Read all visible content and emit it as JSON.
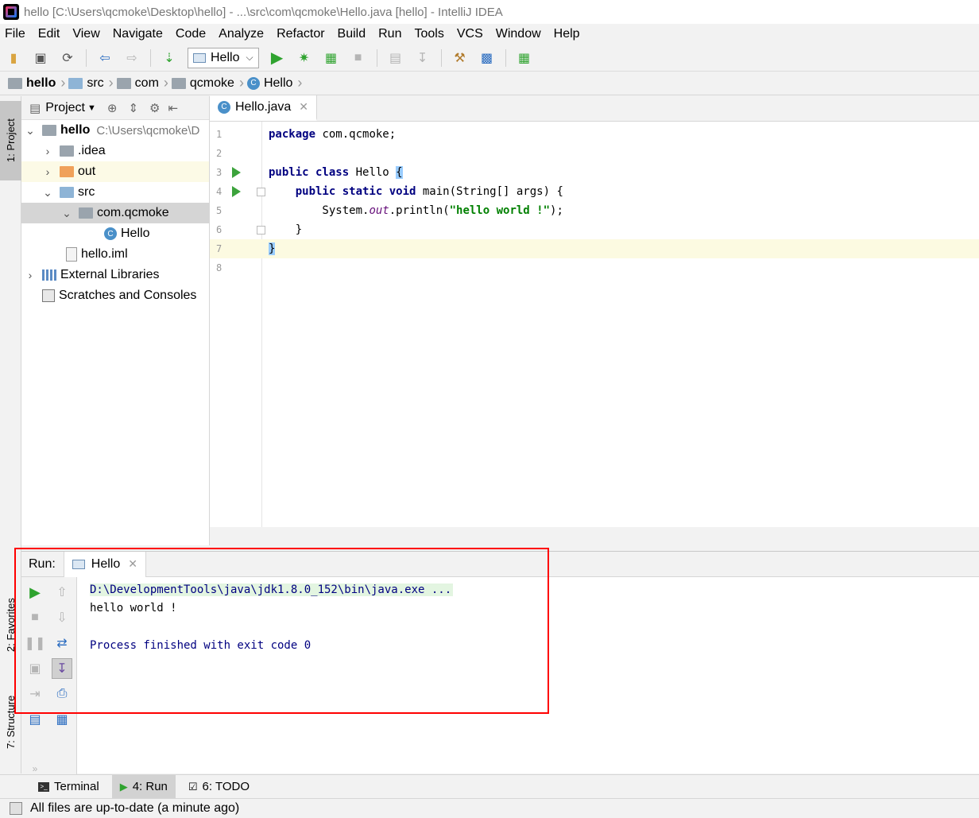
{
  "window": {
    "title": "hello [C:\\Users\\qcmoke\\Desktop\\hello] - ...\\src\\com\\qcmoke\\Hello.java [hello] - IntelliJ IDEA"
  },
  "menubar": {
    "items": [
      "File",
      "Edit",
      "View",
      "Navigate",
      "Code",
      "Analyze",
      "Refactor",
      "Build",
      "Run",
      "Tools",
      "VCS",
      "Window",
      "Help"
    ]
  },
  "toolbar": {
    "run_config": "Hello"
  },
  "breadcrumb": {
    "items": [
      "hello",
      "src",
      "com",
      "qcmoke",
      "Hello"
    ]
  },
  "side_tabs": {
    "project": "1: Project",
    "favorites": "2: Favorites",
    "structure": "7: Structure"
  },
  "project_panel": {
    "title": "Project",
    "tree": {
      "root": "hello",
      "root_path": "C:\\Users\\qcmoke\\D",
      "idea": ".idea",
      "out": "out",
      "src": "src",
      "package": "com.qcmoke",
      "class": "Hello",
      "iml": "hello.iml",
      "libraries": "External Libraries",
      "scratches": "Scratches and Consoles"
    }
  },
  "editor": {
    "tab": "Hello.java",
    "line_numbers": [
      "1",
      "2",
      "3",
      "4",
      "5",
      "6",
      "7",
      "8"
    ],
    "code": {
      "l1_kw": "package",
      "l1_rest": " com.qcmoke;",
      "l3_kw": "public class",
      "l3_name": " Hello ",
      "l3_brace": "{",
      "l4_indent": "    ",
      "l4_kw": "public static void",
      "l4_rest": " main(String[] args) {",
      "l5_a": "        System.",
      "l5_field": "out",
      "l5_b": ".println(",
      "l5_str": "\"hello world !\"",
      "l5_c": ");",
      "l6": "    }",
      "l7": "}"
    }
  },
  "run_panel": {
    "label": "Run:",
    "tab": "Hello",
    "console": {
      "command": "D:\\DevelopmentTools\\java\\jdk1.8.0_152\\bin\\java.exe ...",
      "output": "hello world !",
      "exit": "Process finished with exit code 0"
    }
  },
  "bottom_tabs": {
    "terminal": "Terminal",
    "run": "4: Run",
    "todo": "6: TODO"
  },
  "status": {
    "message": "All files are up-to-date (a minute ago)"
  },
  "colors": {
    "keyword": "#000080",
    "string": "#008000",
    "field": "#660e7a",
    "annotation_box": "#ff0000"
  }
}
